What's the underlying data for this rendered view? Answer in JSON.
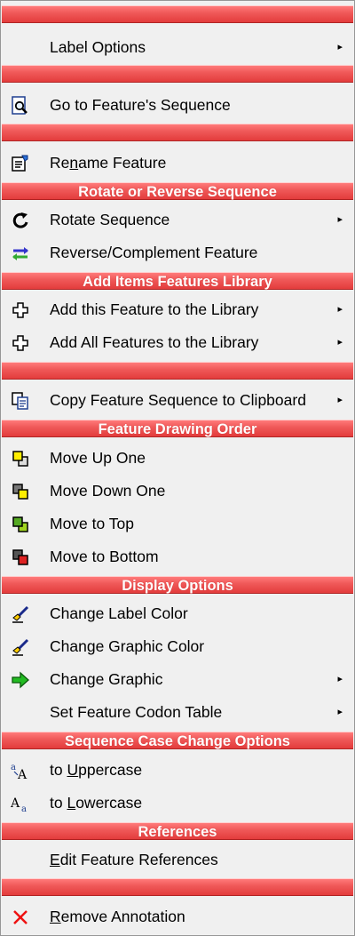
{
  "menu": {
    "headers": {
      "h1": "",
      "h2": "",
      "h3": "",
      "h4": "Rotate or Reverse Sequence",
      "h5": "Add Items Features Library",
      "h6": "",
      "h7": "Feature Drawing Order",
      "h8": "Display Options",
      "h9": "Sequence Case Change Options",
      "h10": "References",
      "h11": ""
    },
    "items": {
      "label_options": "Label Options",
      "go_to_sequence": "Go to Feature's Sequence",
      "rename_pre": "Re",
      "rename_ul": "n",
      "rename_post": "ame Feature",
      "rotate_sequence": "Rotate Sequence",
      "reverse_complement": "Reverse/Complement Feature",
      "add_feature": "Add this Feature to the Library",
      "add_all_features": "Add All Features to the Library",
      "copy_sequence": "Copy Feature Sequence to Clipboard",
      "move_up": "Move Up One",
      "move_down": "Move Down One",
      "move_top": "Move to Top",
      "move_bottom": "Move to Bottom",
      "change_label_color": "Change Label Color",
      "change_graphic_color": "Change Graphic Color",
      "change_graphic": "Change Graphic",
      "set_codon_table": "Set Feature Codon Table",
      "upper_pre": "to ",
      "upper_ul": "U",
      "upper_post": "ppercase",
      "lower_pre": "to ",
      "lower_ul": "L",
      "lower_post": "owercase",
      "edit_refs_ul": "E",
      "edit_refs_post": "dit Feature References",
      "remove_ul": "R",
      "remove_post": "emove Annotation"
    },
    "submenu_arrow": "▸",
    "icons": {
      "go_to_sequence": "magnifier-page-icon",
      "rename": "rename-document-icon",
      "rotate": "rotate-arrow-icon",
      "reverse": "reverse-arrows-icon",
      "add": "plus-outline-icon",
      "copy": "copy-clipboard-icon",
      "move_up": "layer-yellow-icon",
      "move_down": "layer-gray-icon",
      "move_top": "layer-green-icon",
      "move_bottom": "layer-red-icon",
      "paint": "paintbrush-icon",
      "graphic": "green-arrow-icon",
      "uppercase": "uppercase-icon",
      "lowercase": "lowercase-icon",
      "remove": "red-x-icon"
    },
    "colors": {
      "header_red": "#e33c3c",
      "header_text": "#ffffff",
      "background": "#f0f0f0"
    }
  }
}
